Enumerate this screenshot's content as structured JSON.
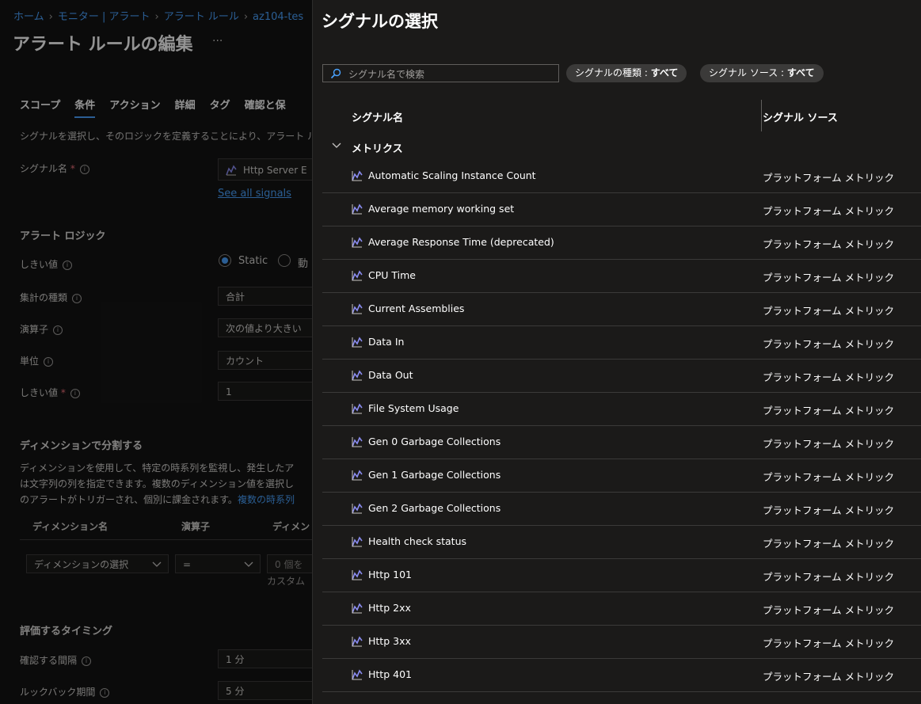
{
  "breadcrumb": [
    "ホーム",
    "モニター | アラート",
    "アラート ルール",
    "az104-tes"
  ],
  "left": {
    "title": "アラート ルールの編集",
    "more": "...",
    "tabs": [
      "スコープ",
      "条件",
      "アクション",
      "詳細",
      "タグ",
      "確認と保"
    ],
    "active_tab": 1,
    "description": "シグナルを選択し、そのロジックを定義することにより、アラート ルー",
    "signal_label": "シグナル名",
    "signal_value": "Http Server E",
    "see_all": "See all signals",
    "logic_heading": "アラート ロジック",
    "threshold_label": "しきい値",
    "threshold_static": "Static",
    "threshold_dynamic": "動",
    "agg_label": "集計の種類",
    "agg_value": "合計",
    "op_label": "演算子",
    "op_value": "次の値より大きい",
    "unit_label": "単位",
    "unit_value": "カウント",
    "thresh2_label": "しきい値",
    "thresh2_value": "1",
    "dim_heading": "ディメンションで分割する",
    "dim_text1": "ディメンションを使用して、特定の時系列を監視し、発生したア",
    "dim_text2": "は文字列の列を指定できます。複数のディメンション値を選択し",
    "dim_text3": "のアラートがトリガーされ、個別に課金されます。",
    "dim_link": "複数の時系列",
    "dim_col1": "ディメンション名",
    "dim_col2": "演算子",
    "dim_col3": "ディメン",
    "dim_select": "ディメンションの選択",
    "dim_op": "=",
    "dim_count": "0 個を",
    "dim_custom": "カスタム",
    "timing_heading": "評価するタイミング",
    "interval_label": "確認する間隔",
    "interval_value": "1 分",
    "lookback_label": "ルックバック期間",
    "lookback_value": "5 分"
  },
  "panel": {
    "title": "シグナルの選択",
    "search_placeholder": "シグナル名で検索",
    "filter_type_label": "シグナルの種類 : ",
    "filter_type_value": "すべて",
    "filter_source_label": "シグナル ソース : ",
    "filter_source_value": "すべて",
    "col_name": "シグナル名",
    "col_source": "シグナル ソース",
    "group": "メトリクス",
    "rows": [
      {
        "name": "Automatic Scaling Instance Count",
        "source": "プラットフォーム メトリック"
      },
      {
        "name": "Average memory working set",
        "source": "プラットフォーム メトリック"
      },
      {
        "name": "Average Response Time (deprecated)",
        "source": "プラットフォーム メトリック"
      },
      {
        "name": "CPU Time",
        "source": "プラットフォーム メトリック"
      },
      {
        "name": "Current Assemblies",
        "source": "プラットフォーム メトリック"
      },
      {
        "name": "Data In",
        "source": "プラットフォーム メトリック"
      },
      {
        "name": "Data Out",
        "source": "プラットフォーム メトリック"
      },
      {
        "name": "File System Usage",
        "source": "プラットフォーム メトリック"
      },
      {
        "name": "Gen 0 Garbage Collections",
        "source": "プラットフォーム メトリック"
      },
      {
        "name": "Gen 1 Garbage Collections",
        "source": "プラットフォーム メトリック"
      },
      {
        "name": "Gen 2 Garbage Collections",
        "source": "プラットフォーム メトリック"
      },
      {
        "name": "Health check status",
        "source": "プラットフォーム メトリック"
      },
      {
        "name": "Http 101",
        "source": "プラットフォーム メトリック"
      },
      {
        "name": "Http 2xx",
        "source": "プラットフォーム メトリック"
      },
      {
        "name": "Http 3xx",
        "source": "プラットフォーム メトリック"
      },
      {
        "name": "Http 401",
        "source": "プラットフォーム メトリック"
      }
    ]
  },
  "colors": {
    "accent": "#4aa3ff",
    "panel_bg": "#1b1a19",
    "metric_icon": "#8a8cf0"
  },
  "icons": {
    "search": "search-icon",
    "metric": "metric-chart-icon",
    "chevron": "chevron-down-icon"
  }
}
